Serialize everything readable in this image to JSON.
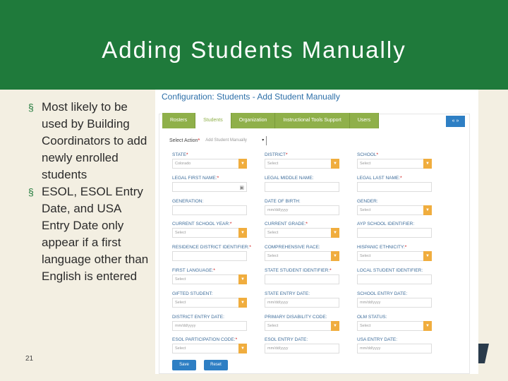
{
  "slide": {
    "title": "Adding Students Manually",
    "bullets": [
      "Most likely to be used by Building Coordinators to add newly enrolled students",
      "ESOL, ESOL Entry Date, and USA Entry Date only appear if a first language other than English is entered"
    ],
    "page_number": "21"
  },
  "app": {
    "title": "Configuration: Students - Add Student Manually",
    "tabs": [
      "Rosters",
      "Students",
      "Organization",
      "Instructional Tools Support",
      "Users"
    ],
    "nav_label": "« »",
    "select_action_label": "Select Action",
    "select_action_value": "Add Student Manually",
    "rows": [
      [
        {
          "label": "STATE",
          "req": true,
          "type": "dd",
          "value": "Colorado"
        },
        {
          "label": "DISTRICT",
          "req": true,
          "type": "dd",
          "value": "Select"
        },
        {
          "label": "SCHOOL",
          "req": true,
          "type": "dd",
          "value": "Select"
        }
      ],
      [
        {
          "label": "LEGAL FIRST NAME:",
          "req": true,
          "type": "txt",
          "value": "",
          "icon": "▣"
        },
        {
          "label": "LEGAL MIDDLE NAME:",
          "req": false,
          "type": "txt",
          "value": ""
        },
        {
          "label": "LEGAL LAST NAME:",
          "req": true,
          "type": "txt",
          "value": ""
        }
      ],
      [
        {
          "label": "GENERATION:",
          "req": false,
          "type": "txt",
          "value": ""
        },
        {
          "label": "DATE OF BIRTH:",
          "req": false,
          "type": "txt",
          "value": "mm/dd/yyyy"
        },
        {
          "label": "GENDER:",
          "req": false,
          "type": "dd",
          "value": "Select"
        }
      ],
      [
        {
          "label": "CURRENT SCHOOL YEAR:",
          "req": true,
          "type": "dd",
          "value": "Select"
        },
        {
          "label": "CURRENT GRADE:",
          "req": true,
          "type": "dd",
          "value": "Select"
        },
        {
          "label": "AYP SCHOOL IDENTIFIER:",
          "req": false,
          "type": "txt",
          "value": ""
        }
      ],
      [
        {
          "label": "RESIDENCE DISTRICT IDENTIFIER:",
          "req": true,
          "type": "txt",
          "value": ""
        },
        {
          "label": "COMPREHENSIVE RACE:",
          "req": false,
          "type": "dd",
          "value": "Select"
        },
        {
          "label": "HISPANIC ETHNICITY:",
          "req": true,
          "type": "dd",
          "value": "Select"
        }
      ],
      [
        {
          "label": "FIRST LANGUAGE:",
          "req": true,
          "type": "dd",
          "value": "Select"
        },
        {
          "label": "STATE STUDENT IDENTIFIER:",
          "req": true,
          "type": "txt",
          "value": ""
        },
        {
          "label": "LOCAL STUDENT IDENTIFIER:",
          "req": false,
          "type": "txt",
          "value": ""
        }
      ],
      [
        {
          "label": "GIFTED STUDENT:",
          "req": false,
          "type": "dd",
          "value": "Select"
        },
        {
          "label": "STATE ENTRY DATE:",
          "req": false,
          "type": "txt",
          "value": "mm/dd/yyyy"
        },
        {
          "label": "SCHOOL ENTRY DATE:",
          "req": false,
          "type": "txt",
          "value": "mm/dd/yyyy"
        }
      ],
      [
        {
          "label": "DISTRICT ENTRY DATE:",
          "req": false,
          "type": "txt",
          "value": "mm/dd/yyyy"
        },
        {
          "label": "PRIMARY DISABILITY CODE:",
          "req": false,
          "type": "dd",
          "value": "Select"
        },
        {
          "label": "OLM STATUS:",
          "req": false,
          "type": "dd",
          "value": "Select"
        }
      ],
      [
        {
          "label": "ESOL PARTICIPATION CODE:",
          "req": true,
          "type": "dd",
          "value": "Select"
        },
        {
          "label": "ESOL ENTRY DATE:",
          "req": false,
          "type": "txt",
          "value": "mm/dd/yyyy"
        },
        {
          "label": "USA ENTRY DATE:",
          "req": false,
          "type": "txt",
          "value": "mm/dd/yyyy"
        }
      ]
    ],
    "save_label": "Save",
    "reset_label": "Reset"
  },
  "colors": {
    "header": "#1f7a3b",
    "tab": "#8fb04a",
    "dropdown_button": "#f0ad3e",
    "button": "#2e7fc4"
  }
}
